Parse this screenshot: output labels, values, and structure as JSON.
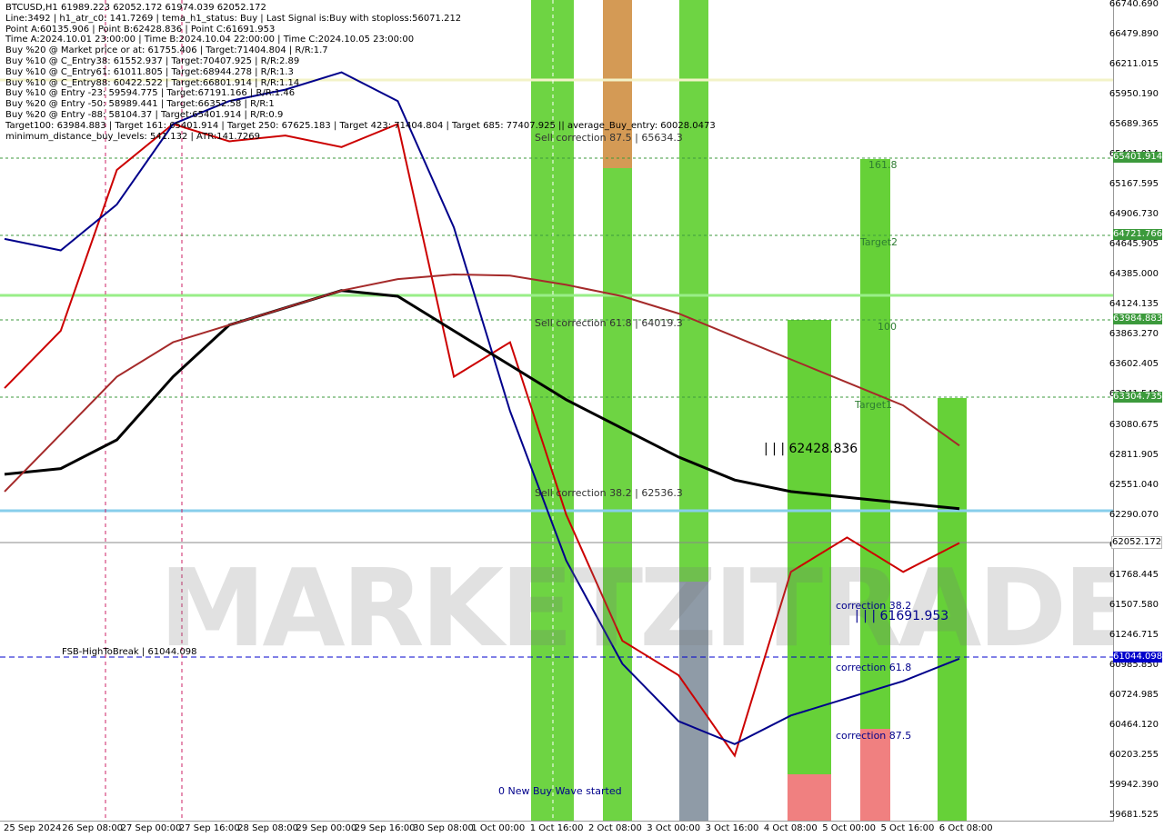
{
  "header": {
    "lines": [
      "BTCUSD,H1  61989.223 62052.172 61974.039 62052.172",
      "Line:3492 | h1_atr_c0: 141.7269 | tema_h1_status: Buy | Last Signal is:Buy with stoploss:56071.212",
      "Point A:60135.906 | Point B:62428.836 | Point C:61691.953",
      "Time A:2024.10.01 23:00:00 | Time B:2024.10.04 22:00:00 | Time C:2024.10.05 23:00:00",
      "Buy %20 @ Market price or at: 61755.406 | Target:71404.804 | R/R:1.7",
      "Buy %10 @ C_Entry38: 61552.937 | Target:70407.925 | R/R:2.89",
      "Buy %10 @ C_Entry61: 61011.805 | Target:68944.278 | R/R:1.3",
      "Buy %10 @ C_Entry88: 60422.522 | Target:66801.914 | R/R:1.14",
      "Buy %10 @ Entry -23: 59594.775 | Target:67191.166 | R/R:1.46",
      "Buy %20 @ Entry -50: 58989.441 | Target:66352.58 | R/R:1",
      "Buy %20 @ Entry -88: 58104.37 | Target:65401.914 | R/R:0.9",
      "Target100: 63984.883 | Target 161: 65401.914 | Target 250: 67625.183 | Target 423: 71404.804 | Target 685: 77407.925 || average_Buy_entry: 60028.0473",
      "minimum_distance_buy_levels: 541.132 | ATR:141.7269"
    ]
  },
  "watermark": "MARKETZITRADE",
  "y_ticks": [
    "66740.690",
    "66479.890",
    "66211.015",
    "65950.190",
    "65689.365",
    "65401.914",
    "65167.595",
    "64906.730",
    "64645.905",
    "64385.000",
    "64124.135",
    "63863.270",
    "63602.405",
    "63341.540",
    "63080.675",
    "62811.905",
    "62551.040",
    "62290.070",
    "62029.270",
    "61768.445",
    "61507.580",
    "61246.715",
    "60985.850",
    "60724.985",
    "60464.120",
    "60203.255",
    "59942.390",
    "59681.525"
  ],
  "x_ticks": [
    "25 Sep 2024",
    "26 Sep 08:00",
    "27 Sep 00:00",
    "27 Sep 16:00",
    "28 Sep 08:00",
    "29 Sep 00:00",
    "29 Sep 16:00",
    "30 Sep 08:00",
    "1 Oct 00:00",
    "1 Oct 16:00",
    "2 Oct 08:00",
    "3 Oct 00:00",
    "3 Oct 16:00",
    "4 Oct 08:00",
    "5 Oct 00:00",
    "5 Oct 16:00",
    "6 Oct 08:00"
  ],
  "price_tags": {
    "t1": "65401.914",
    "t2": "64721.766",
    "t3": "63984.883",
    "t4": "63304.735",
    "current": "62052.172",
    "fsb": "61044.098"
  },
  "labels": {
    "sell_875": "Sell correction 87.5 | 65634.3",
    "sell_618": "Sell correction 61.8 | 64019.3",
    "sell_382": "Sell correction 38.2 | 62536.3",
    "target161": "161.8",
    "target2": "Target2",
    "t100": "100",
    "target1": "Target1",
    "pointB": "| | | 62428.836",
    "pointC": "| | | 61691.953",
    "corr382": "correction 38.2",
    "corr618": "correction 61.8",
    "corr875": "correction 87.5",
    "new_wave": "0 New Buy Wave started",
    "fsb": "FSB-HighToBreak | 61044.098"
  },
  "chart_data": {
    "type": "line",
    "symbol": "BTCUSD",
    "timeframe": "H1",
    "ohlc_last": {
      "open": 61989.223,
      "high": 62052.172,
      "low": 61974.039,
      "close": 62052.172
    },
    "ylim": [
      59681.525,
      66740.69
    ],
    "x": [
      "25 Sep 2024",
      "26 Sep 08:00",
      "27 Sep 00:00",
      "27 Sep 16:00",
      "28 Sep 08:00",
      "29 Sep 00:00",
      "29 Sep 16:00",
      "30 Sep 08:00",
      "1 Oct 00:00",
      "1 Oct 16:00",
      "2 Oct 08:00",
      "3 Oct 00:00",
      "3 Oct 16:00",
      "4 Oct 08:00",
      "5 Oct 00:00",
      "5 Oct 16:00",
      "6 Oct 08:00"
    ],
    "series": [
      {
        "values": [
          63400,
          63900,
          65300,
          65700,
          65550,
          65600,
          65500,
          65700,
          63500,
          63800,
          62300,
          61200,
          60900,
          60200,
          61800,
          62100,
          61800,
          62052
        ],
        "color": "#cc0000"
      },
      {
        "values": [
          64700,
          64600,
          65000,
          65700,
          65900,
          66000,
          66150,
          65900,
          64800,
          63200,
          61900,
          61000,
          60500,
          60300,
          60550,
          60700,
          60850,
          61044
        ],
        "color": "#00008b"
      },
      {
        "values": [
          62650,
          62700,
          62950,
          63500,
          63950,
          64100,
          64250,
          64200,
          63900,
          63600,
          63300,
          63050,
          62800,
          62600,
          62500,
          62450,
          62400,
          62350
        ],
        "color": "#000000"
      },
      {
        "values": [
          62500,
          63000,
          63500,
          63800,
          63950,
          64100,
          64250,
          64350,
          64390,
          64380,
          64300,
          64200,
          64050,
          63850,
          63650,
          63450,
          63250,
          62900
        ],
        "color": "#a52a2a"
      }
    ],
    "levels": [
      {
        "name": "Target161",
        "value": 65401.914
      },
      {
        "name": "Target2",
        "value": 64721.766
      },
      {
        "name": "Target100",
        "value": 63984.883
      },
      {
        "name": "Target1",
        "value": 63304.735
      },
      {
        "name": "Current",
        "value": 62052.172
      },
      {
        "name": "FSB-HighToBreak",
        "value": 61044.098
      }
    ]
  }
}
